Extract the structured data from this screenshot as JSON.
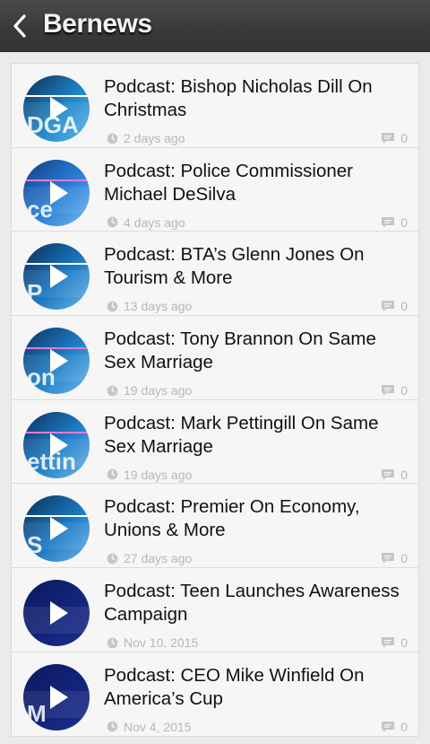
{
  "header": {
    "title": "Bernews"
  },
  "icons": {
    "back": "chevron-left-icon",
    "clock": "clock-icon",
    "comment": "comment-bubble-icon",
    "play": "play-icon"
  },
  "colors": {
    "header_bg": "#3a3a3a",
    "meta_text": "#b7b7b7"
  },
  "items": [
    {
      "title": "Podcast: Bishop Nicholas Dill On Christmas",
      "date": "2 days ago",
      "comments": "0",
      "thumb": {
        "bg": [
          "#0b2f55",
          "#1f86c9",
          "#5fb7e6"
        ],
        "stripe": "#ffffff",
        "text": "DGA"
      }
    },
    {
      "title": "Podcast: Police Commissioner Michael DeSilva",
      "date": "4 days ago",
      "comments": "0",
      "thumb": {
        "bg": [
          "#0d3f86",
          "#2a7fd6",
          "#70b7f2"
        ],
        "stripe": "#e27bd7",
        "text": "ce"
      }
    },
    {
      "title": "Podcast: BTA’s Glenn Jones On Tourism & More",
      "date": "13 days ago",
      "comments": "0",
      "thumb": {
        "bg": [
          "#0a2d55",
          "#1b77c2",
          "#6ab5e8"
        ],
        "stripe": "#ffffff",
        "text": "P"
      }
    },
    {
      "title": "Podcast: Tony Brannon On Same Sex Marriage",
      "date": "19 days ago",
      "comments": "0",
      "thumb": {
        "bg": [
          "#0a3161",
          "#1f80c8",
          "#6fb6ea"
        ],
        "stripe": "#e27bd7",
        "text": "on"
      }
    },
    {
      "title": "Podcast: Mark Pettingill On Same Sex Marriage",
      "date": "19 days ago",
      "comments": "0",
      "thumb": {
        "bg": [
          "#0a3161",
          "#1f80c8",
          "#6fb6ea"
        ],
        "stripe": "#e27bd7",
        "text": "ettin"
      }
    },
    {
      "title": "Podcast: Premier On Economy, Unions & More",
      "date": "27 days ago",
      "comments": "0",
      "thumb": {
        "bg": [
          "#0b2f55",
          "#1b78c4",
          "#6ab5e8"
        ],
        "stripe": "#ffffff",
        "text": "S"
      }
    },
    {
      "title": "Podcast: Teen Launches Awareness Campaign",
      "date": "Nov 10, 2015",
      "comments": "0",
      "thumb": {
        "bg": [
          "#0c1a5f",
          "#13237a",
          "#1a2e8e"
        ],
        "stripe": "none",
        "text": ""
      }
    },
    {
      "title": "Podcast: CEO Mike Winfield On America’s Cup",
      "date": "Nov 4, 2015",
      "comments": "0",
      "thumb": {
        "bg": [
          "#0c1a5f",
          "#13237a",
          "#1a2e8e"
        ],
        "stripe": "none",
        "text": "M"
      }
    }
  ]
}
